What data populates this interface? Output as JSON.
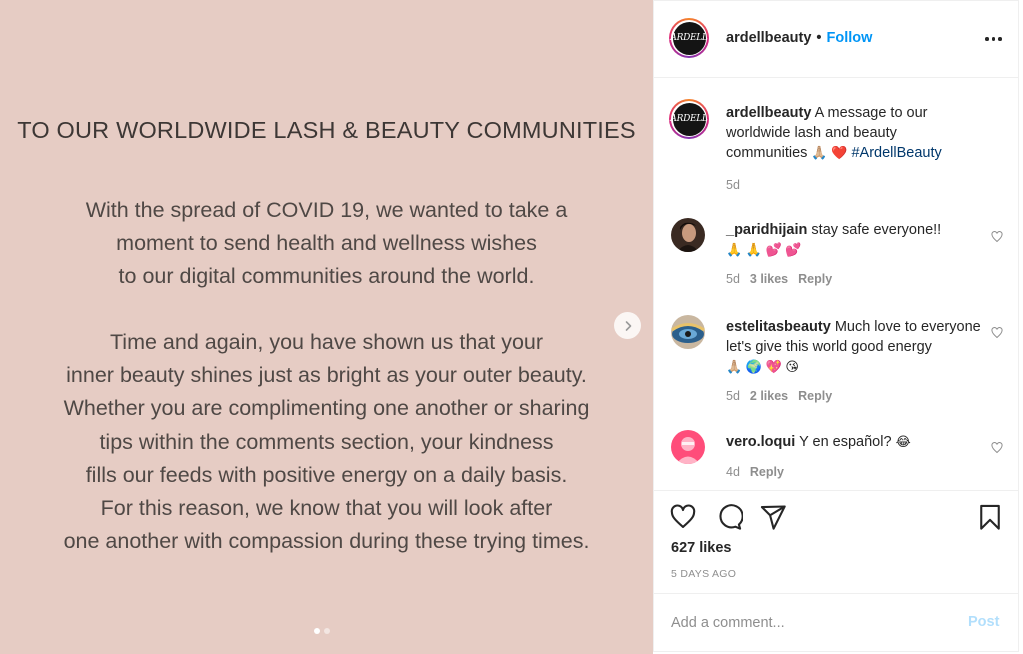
{
  "post_image": {
    "headline": "TO OUR WORLDWIDE LASH & BEAUTY COMMUNITIES",
    "paragraph1": [
      "With the spread of COVID 19, we wanted to take a",
      "moment to send health and wellness wishes",
      "to our digital communities around the world."
    ],
    "paragraph2": [
      "Time and again, you have shown us that your",
      "inner beauty shines just as bright as your outer beauty.",
      "Whether you are complimenting one another or sharing",
      "tips within the comments section, your kindness",
      "fills our feeds with positive energy on a daily basis.",
      "For this reason, we know that you will look after",
      "one another with compassion during these trying times."
    ],
    "background_color": "#e6ccc4",
    "carousel": {
      "slide_count": 2,
      "active_index": 0
    }
  },
  "header": {
    "username": "ardellbeauty",
    "separator": "•",
    "follow_label": "Follow",
    "avatar_logo_text": "ARDELL"
  },
  "caption": {
    "username": "ardellbeauty",
    "text": "A message to our worldwide lash and beauty communities",
    "emojis": "🙏🏼 ❤️",
    "hashtag": "#ArdellBeauty",
    "time": "5d"
  },
  "comments": [
    {
      "username": "_paridhijain",
      "text": "stay safe everyone!!",
      "emojis": "🙏 🙏 💕 💕",
      "time": "5d",
      "likes": "3 likes",
      "reply_label": "Reply"
    },
    {
      "username": "estelitasbeauty",
      "text": "Much love to everyone let's give this world good energy",
      "emojis": "🙏🏼 🌍 💖 😘",
      "time": "5d",
      "likes": "2 likes",
      "reply_label": "Reply"
    },
    {
      "username": "vero.loqui",
      "text": "Y en español?",
      "emojis": "😂",
      "time": "4d",
      "likes": "",
      "reply_label": "Reply"
    }
  ],
  "actions": {
    "likes": "627 likes",
    "time_ago": "5 DAYS AGO"
  },
  "add_comment": {
    "placeholder": "Add a comment...",
    "post_label": "Post"
  },
  "colors": {
    "accent": "#0095f6",
    "hashtag": "#00376b",
    "muted": "#8e8e8e",
    "post_disabled": "#b2dffc"
  }
}
